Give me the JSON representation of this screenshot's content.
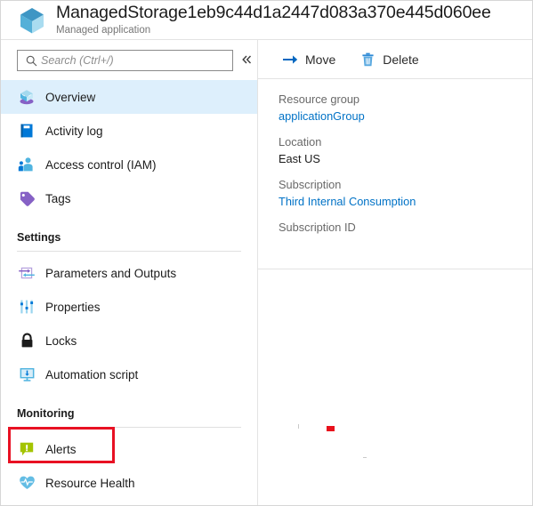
{
  "header": {
    "title": "ManagedStorage1eb9c44d1a2447d083a370e445d060ee",
    "subtitle": "Managed application",
    "icon": "managed-application-cube-icon"
  },
  "sidebar": {
    "search": {
      "placeholder": "Search (Ctrl+/)",
      "value": "",
      "icon": "search-icon"
    },
    "collapse": {
      "icon": "double-chevron-left-icon",
      "label": "«"
    },
    "top_items": [
      {
        "label": "Overview",
        "icon": "overview-cube-icon",
        "selected": true
      },
      {
        "label": "Activity log",
        "icon": "activity-log-book-icon",
        "selected": false
      },
      {
        "label": "Access control (IAM)",
        "icon": "access-control-people-icon",
        "selected": false
      },
      {
        "label": "Tags",
        "icon": "tag-icon",
        "selected": false
      }
    ],
    "groups": [
      {
        "title": "Settings",
        "items": [
          {
            "label": "Parameters and Outputs",
            "icon": "parameters-arrows-icon",
            "selected": false
          },
          {
            "label": "Properties",
            "icon": "properties-sliders-icon",
            "selected": false
          },
          {
            "label": "Locks",
            "icon": "lock-icon",
            "selected": false
          },
          {
            "label": "Automation script",
            "icon": "automation-script-monitor-icon",
            "selected": false
          }
        ]
      },
      {
        "title": "Monitoring",
        "items": [
          {
            "label": "Alerts",
            "icon": "alerts-bubble-icon",
            "selected": false,
            "highlighted": true
          },
          {
            "label": "Resource Health",
            "icon": "resource-health-heart-icon",
            "selected": false
          }
        ]
      }
    ]
  },
  "toolbar": {
    "buttons": [
      {
        "label": "Move",
        "icon": "move-arrow-icon"
      },
      {
        "label": "Delete",
        "icon": "delete-trash-icon"
      }
    ]
  },
  "essentials": {
    "fields": [
      {
        "label": "Resource group",
        "value": "applicationGroup",
        "is_link": true
      },
      {
        "label": "Location",
        "value": "East US",
        "is_link": false
      },
      {
        "label": "Subscription",
        "value": "Third Internal Consumption",
        "is_link": true
      },
      {
        "label": "Subscription ID",
        "value": "",
        "is_link": false
      }
    ]
  },
  "colors": {
    "accent_link": "#0072c6",
    "selected_row": "#ddeffc",
    "highlight_border": "#e81123",
    "label_gray": "#696969",
    "title_black": "#1b1b1b"
  }
}
